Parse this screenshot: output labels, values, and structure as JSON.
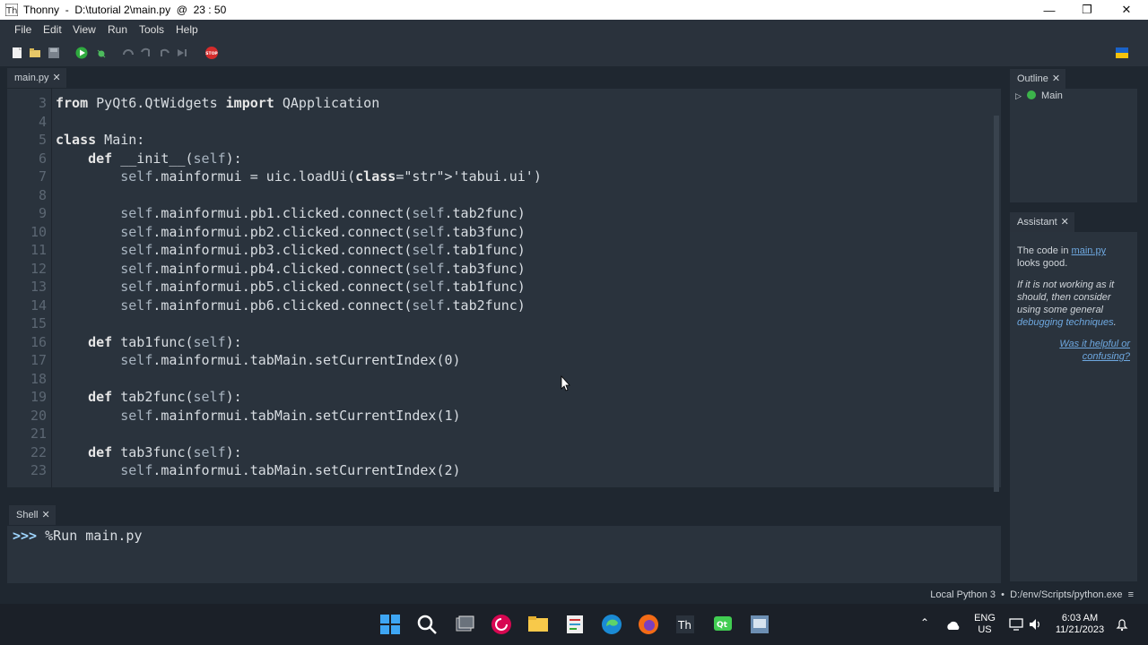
{
  "window": {
    "title": "Thonny  -  D:\\tutorial 2\\main.py  @  23 : 50"
  },
  "menu": [
    "File",
    "Edit",
    "View",
    "Run",
    "Tools",
    "Help"
  ],
  "toolbar": {
    "stop_label": "STOP"
  },
  "editor": {
    "tab": "main.py",
    "lines": [
      {
        "n": "3",
        "text": "from PyQt6.QtWidgets import QApplication"
      },
      {
        "n": "4",
        "text": ""
      },
      {
        "n": "5",
        "text": "class Main:"
      },
      {
        "n": "6",
        "text": "    def __init__(self):"
      },
      {
        "n": "7",
        "text": "        self.mainformui = uic.loadUi('tabui.ui')"
      },
      {
        "n": "8",
        "text": ""
      },
      {
        "n": "9",
        "text": "        self.mainformui.pb1.clicked.connect(self.tab2func)"
      },
      {
        "n": "10",
        "text": "        self.mainformui.pb2.clicked.connect(self.tab3func)"
      },
      {
        "n": "11",
        "text": "        self.mainformui.pb3.clicked.connect(self.tab1func)"
      },
      {
        "n": "12",
        "text": "        self.mainformui.pb4.clicked.connect(self.tab3func)"
      },
      {
        "n": "13",
        "text": "        self.mainformui.pb5.clicked.connect(self.tab1func)"
      },
      {
        "n": "14",
        "text": "        self.mainformui.pb6.clicked.connect(self.tab2func)"
      },
      {
        "n": "15",
        "text": ""
      },
      {
        "n": "16",
        "text": "    def tab1func(self):"
      },
      {
        "n": "17",
        "text": "        self.mainformui.tabMain.setCurrentIndex(0)"
      },
      {
        "n": "18",
        "text": ""
      },
      {
        "n": "19",
        "text": "    def tab2func(self):"
      },
      {
        "n": "20",
        "text": "        self.mainformui.tabMain.setCurrentIndex(1)"
      },
      {
        "n": "21",
        "text": ""
      },
      {
        "n": "22",
        "text": "    def tab3func(self):"
      },
      {
        "n": "23",
        "text": "        self.mainformui.tabMain.setCurrentIndex(2)"
      }
    ]
  },
  "outline": {
    "tab": "Outline",
    "items": [
      "Main"
    ]
  },
  "assistant": {
    "tab": "Assistant",
    "msg_prefix": "The code in ",
    "msg_link": "main.py",
    "msg_suffix": " looks good.",
    "hint_prefix": "If it is not working as it should, then consider using some general ",
    "hint_link": "debugging techniques",
    "hint_suffix": ".",
    "feedback": "Was it helpful or confusing?"
  },
  "shell": {
    "tab": "Shell",
    "prompt": ">>> ",
    "command": "%Run main.py"
  },
  "status": {
    "text": "Local Python 3  •  D:/env/Scripts/python.exe  ≡"
  },
  "taskbar": {
    "lang": "ENG",
    "region": "US",
    "time": "6:03 AM",
    "date": "11/21/2023"
  }
}
